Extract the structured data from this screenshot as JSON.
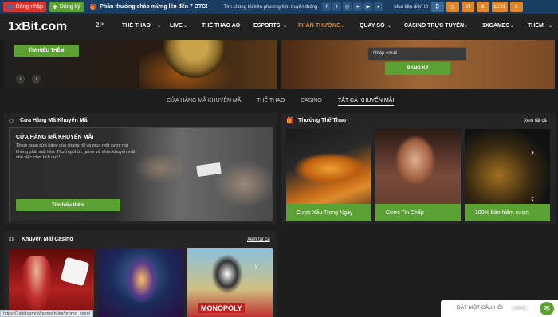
{
  "topbar": {
    "register_label": "Đăng nhập",
    "signup_label": "Đăng ký",
    "promo_text": "Phần thưởng chào mừng lên đến 7 BTC!",
    "news_text": "Tìm chúng tôi trên phương tiện truyền thông",
    "buy_text": "Mua tiền điện tử",
    "language": "VI",
    "time": "15:21",
    "colors": {
      "bar": "#1a3d63",
      "login": "#d8352d",
      "register": "#5ba134",
      "accent": "#e0872b"
    }
  },
  "nav": {
    "logo_text": "1xBit.com",
    "items": [
      "THỂ THAO",
      "LIVE",
      "THỂ THAO ẢO",
      "ESPORTS",
      "PHẦN THƯỞNG",
      "QUAY SỐ",
      "CASINO TRỰC TUYẾN",
      "1XGAMES",
      "THÊM"
    ],
    "active": "PHẦN THƯỞNG"
  },
  "hero": {
    "left_button": "TÌM HIỂU THÊM",
    "email_placeholder": "Nhập email",
    "signup_button": "ĐĂNG KÝ"
  },
  "tabs": [
    "CỬA HÀNG MÃ KHUYẾN MÃI",
    "THỂ THAO",
    "CASINO",
    "TẤT CẢ KHUYẾN MÃI"
  ],
  "promo_store": {
    "title": "Cửa Hàng Mã Khuyến Mãi",
    "card_title": "CỬA HÀNG MÃ KHUYẾN MÃI",
    "card_text": "Tham quan cửa hàng của chúng tôi và mua một cược mà không phải mất tiền. Thưởng thức game và nhận khuyến mãi cho việc chơi tích cực!",
    "button": "Tìm hiểu thêm"
  },
  "sports_bonus": {
    "title": "Thưởng Thể Thao",
    "see_all": "Xem tất cả",
    "cards": [
      "Cược Xấu Trong Ngày",
      "Cược Tin Chấp",
      "100% bảo hiểm cược"
    ]
  },
  "casino_promo": {
    "title": "Khuyến Mãi Casino",
    "see_all": "Xem tất cả",
    "card3_text": "MONOPOLY"
  },
  "status_url": "https://1xbit.com/vi/bonus/rules/promo_store/",
  "chat": {
    "label": "ĐẶT MỘT CÂU HỎI",
    "status": "online"
  }
}
